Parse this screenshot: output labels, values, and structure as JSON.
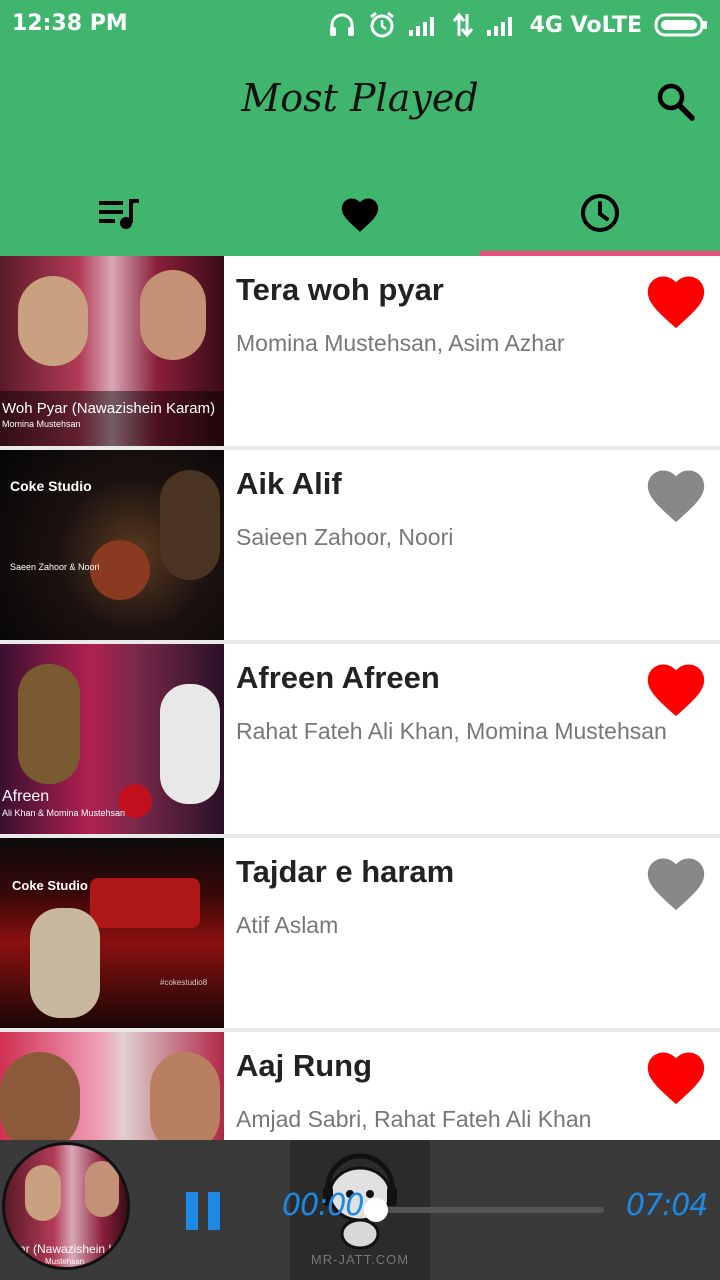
{
  "status_bar": {
    "time": "12:38 PM",
    "network": "4G VoLTE",
    "icons": [
      "headphones-icon",
      "alarm-icon",
      "signal-icon",
      "data-arrows-icon",
      "signal-icon",
      "battery-icon"
    ]
  },
  "app_bar": {
    "title": "Most Played",
    "search_icon": "search-icon"
  },
  "tabs": [
    {
      "icon": "playlist-icon",
      "active": false
    },
    {
      "icon": "heart-icon",
      "active": false
    },
    {
      "icon": "clock-icon",
      "active": true
    }
  ],
  "songs": [
    {
      "title": "Tera woh pyar",
      "artists": "Momina Mustehsan, Asim Azhar",
      "favorite": true,
      "thumb_caption": "Woh Pyar (Nawazishein Karam)",
      "thumb_subcaption": "Momina Mustehsan"
    },
    {
      "title": "Aik Alif",
      "artists": "Saieen Zahoor, Noori",
      "favorite": false,
      "thumb_caption": "Coke Studio",
      "thumb_subcaption": "Saeen Zahoor & Noori"
    },
    {
      "title": "Afreen Afreen",
      "artists": "Rahat Fateh Ali Khan, Momina Mustehsan",
      "favorite": true,
      "thumb_caption": "Afreen",
      "thumb_subcaption": "Ali Khan & Momina Mustehsan"
    },
    {
      "title": "Tajdar e haram",
      "artists": "Atif Aslam",
      "favorite": false,
      "thumb_caption": "Coke Studio",
      "thumb_subcaption": "#cokestudio8"
    },
    {
      "title": "Aaj Rung",
      "artists": "Amjad Sabri,  Rahat Fateh Ali Khan",
      "favorite": true,
      "thumb_caption": "",
      "thumb_subcaption": ""
    }
  ],
  "player": {
    "now_playing_caption": "yar (Nawazishein Kar",
    "now_playing_subcaption": "Mustehsan",
    "elapsed": "00:00",
    "duration": "07:04",
    "progress": 0.0,
    "watermark": "MR-JATT.COM"
  },
  "colors": {
    "primary": "#3fb56e",
    "tab_indicator": "#ec4d7f",
    "favorite_on": "#ff0000",
    "favorite_off": "#888888",
    "player_accent": "#1e88e5",
    "player_bg": "#3a3a3a"
  }
}
